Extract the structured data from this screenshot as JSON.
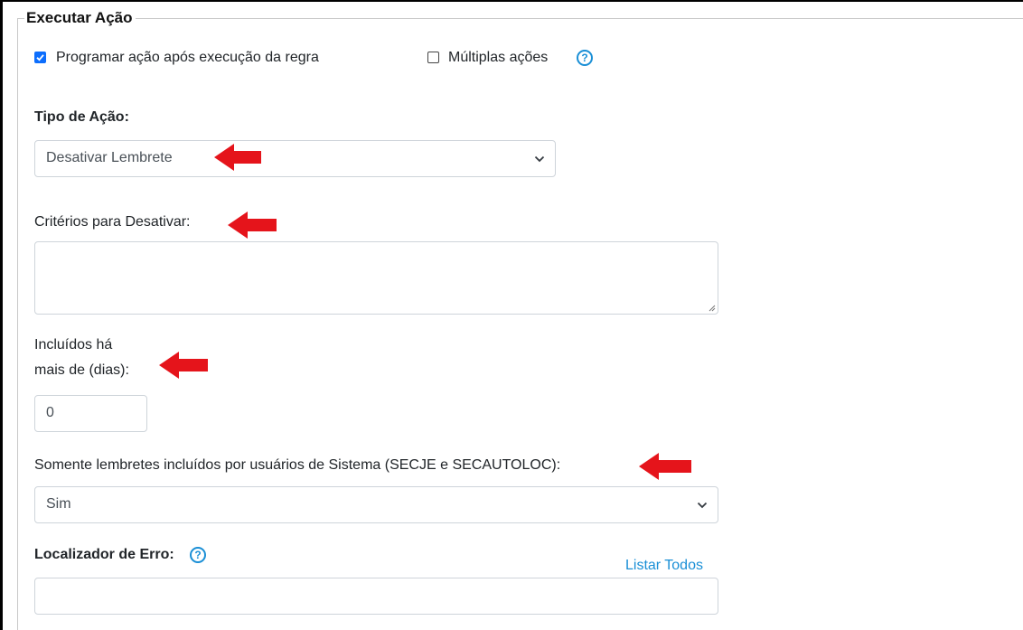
{
  "section": {
    "legend": "Executar Ação"
  },
  "options": {
    "program_label": "Programar ação após execução da regra",
    "program_checked": true,
    "multiple_label": "Múltiplas ações",
    "multiple_checked": false,
    "help_glyph": "?"
  },
  "action_type": {
    "label": "Tipo de Ação:",
    "selected": "Desativar Lembrete"
  },
  "criteria": {
    "label": "Critérios para Desativar:",
    "value": ""
  },
  "days": {
    "label_line1": "Incluídos há",
    "label_line2": "mais de (dias):",
    "value": "0"
  },
  "system_users": {
    "label": "Somente lembretes incluídos por usuários de Sistema (SECJE e SECAUTOLOC):",
    "selected": "Sim"
  },
  "error_locator": {
    "label": "Localizador de Erro:",
    "list_all_link": "Listar Todos",
    "value": ""
  },
  "annotations": {
    "arrow_color": "#e5141b",
    "arrow_icon": "left-arrow-icon"
  }
}
